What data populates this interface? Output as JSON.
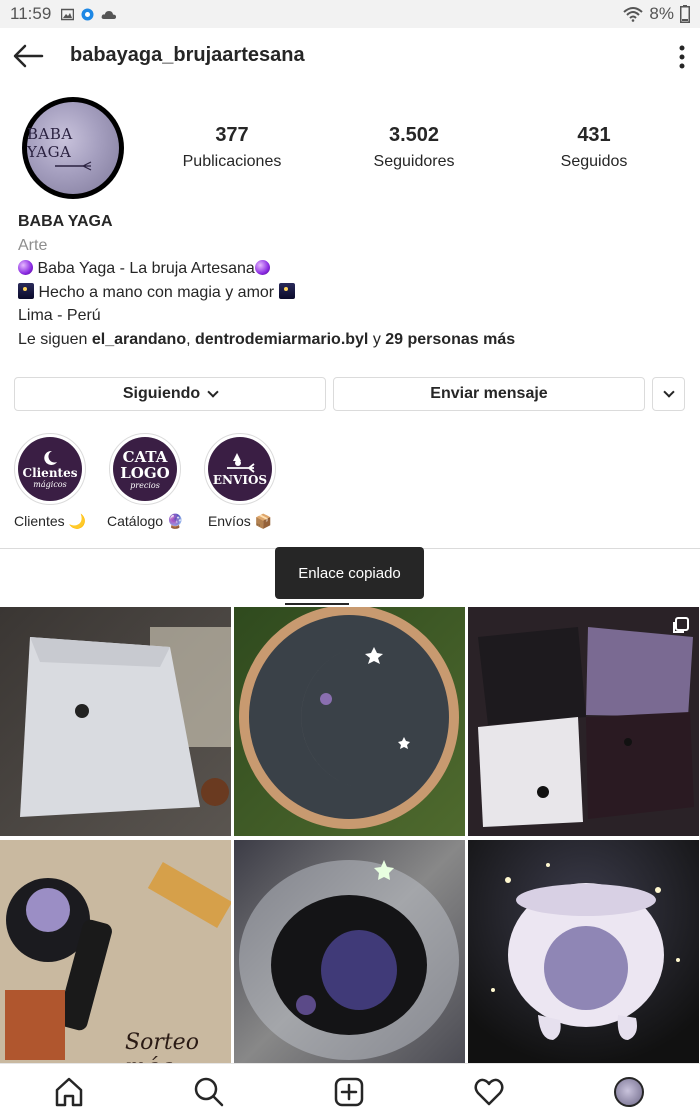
{
  "status_bar": {
    "time": "11:59",
    "battery": "8%"
  },
  "header": {
    "username": "babayaga_brujaartesana"
  },
  "avatar": {
    "text": "BABA YAGA"
  },
  "stats": [
    {
      "value": "377",
      "label": "Publicaciones"
    },
    {
      "value": "3.502",
      "label": "Seguidores"
    },
    {
      "value": "431",
      "label": "Seguidos"
    }
  ],
  "bio": {
    "name": "BABA YAGA",
    "category": "Arte",
    "line1": " Baba Yaga - La bruja Artesana",
    "line2": " Hecho a mano con magia y amor ",
    "line3": "Lima - Perú",
    "followed_prefix": "Le siguen ",
    "followed_user1": "el_arandano",
    "followed_sep": ", ",
    "followed_user2": "dentrodemiarmario.byl",
    "followed_and": " y ",
    "followed_more": "29 personas más"
  },
  "buttons": {
    "following": "Siguiendo",
    "message": "Enviar mensaje"
  },
  "highlights": [
    {
      "circle_text": "Clientes",
      "circle_sub": "mágicos",
      "label": "Clientes 🌙"
    },
    {
      "circle_text": "CATA LOGO",
      "circle_sub": "precios",
      "label": "Catálogo 🔮"
    },
    {
      "circle_text": "ENVIOS",
      "circle_sub": "",
      "label": "Envíos 📦"
    }
  ],
  "toast": {
    "text": "Enlace copiado"
  },
  "grid": {
    "tiles": [
      {
        "name": "white-shirt-post"
      },
      {
        "name": "moon-hoop-post"
      },
      {
        "name": "tees-collage-post",
        "multi": true
      },
      {
        "name": "cauldron-giveaway-post",
        "caption": "Sorteo mág"
      },
      {
        "name": "black-cauldron-post"
      },
      {
        "name": "white-cauldron-post"
      }
    ]
  },
  "icons": {
    "back": "arrow-left-icon",
    "menu": "more-vertical-icon",
    "home": "home-icon",
    "search": "search-icon",
    "add": "add-post-icon",
    "activity": "heart-icon"
  },
  "colors": {
    "text": "#262626",
    "secondary": "#8e8e8e",
    "border": "#dbdbdb",
    "highlight_bg": "#3a1e44"
  }
}
